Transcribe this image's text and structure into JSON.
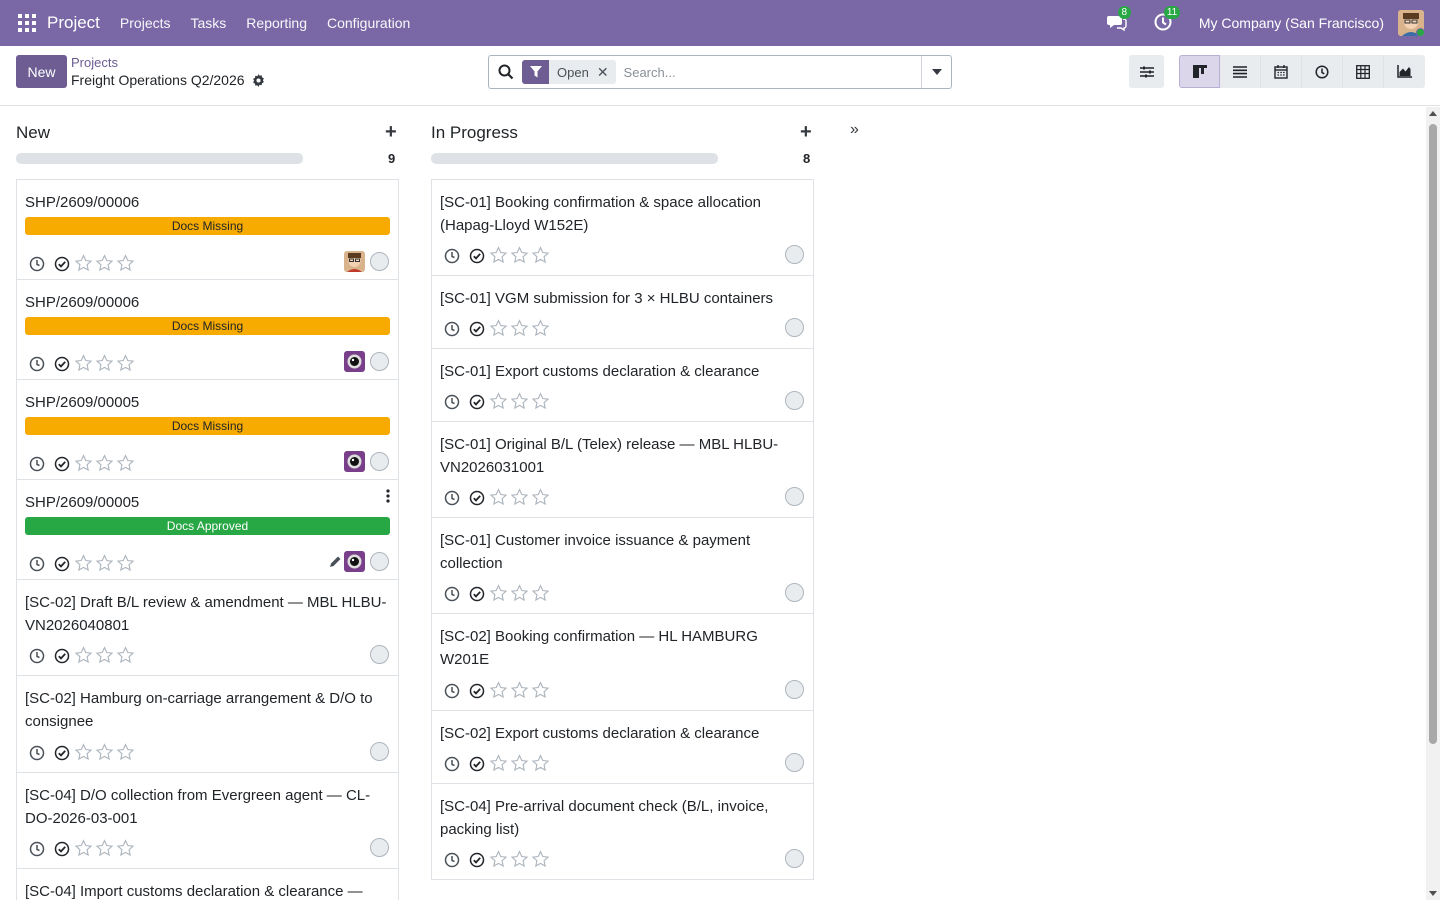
{
  "navbar": {
    "brand": "Project",
    "menu": [
      "Projects",
      "Tasks",
      "Reporting",
      "Configuration"
    ],
    "messages_count": "8",
    "activities_count": "11",
    "company": "My Company (San Francisco)",
    "accent_color": "#7a68a6"
  },
  "control": {
    "new_label": "New",
    "breadcrumb_parent": "Projects",
    "breadcrumb_current": "Freight Operations Q2/2026",
    "filter_facet": "Open",
    "search_placeholder": "Search...",
    "views": [
      "kanban-icon",
      "list-icon",
      "calendar-icon",
      "activity-icon",
      "pivot-icon",
      "graph-icon"
    ],
    "active_view": "kanban"
  },
  "columns": [
    {
      "title": "New",
      "count": "9",
      "cards": [
        {
          "title": "SHP/2609/00006",
          "tag": "Docs Missing",
          "tag_type": "missing",
          "assignee": "avatar-cartoon"
        },
        {
          "title": "SHP/2609/00006",
          "tag": "Docs Missing",
          "tag_type": "missing",
          "assignee": "avatar-camera"
        },
        {
          "title": "SHP/2609/00005",
          "tag": "Docs Missing",
          "tag_type": "missing",
          "assignee": "avatar-camera"
        },
        {
          "title": "SHP/2609/00005",
          "tag": "Docs Approved",
          "tag_type": "approved",
          "assignee": "avatar-camera"
        },
        {
          "title": "[SC-02] Draft B/L review & amendment — MBL HLBU-VN2026040801",
          "tag": "",
          "tag_type": "",
          "assignee": ""
        },
        {
          "title": "[SC-02] Hamburg on-carriage arrangement & D/O to consignee",
          "tag": "",
          "tag_type": "",
          "assignee": ""
        },
        {
          "title": "[SC-04] D/O collection from Evergreen agent — CL-DO-2026-03-001",
          "tag": "",
          "tag_type": "",
          "assignee": ""
        },
        {
          "title": "[SC-04] Import customs declaration & clearance —",
          "tag": "",
          "tag_type": "",
          "assignee": ""
        }
      ]
    },
    {
      "title": "In Progress",
      "count": "8",
      "cards": [
        {
          "title": "[SC-01] Booking confirmation & space allocation (Hapag-Lloyd W152E)"
        },
        {
          "title": "[SC-01] VGM submission for 3 × HLBU containers"
        },
        {
          "title": "[SC-01] Export customs declaration & clearance"
        },
        {
          "title": "[SC-01] Original B/L (Telex) release — MBL HLBU-VN2026031001"
        },
        {
          "title": "[SC-01] Customer invoice issuance & payment collection"
        },
        {
          "title": "[SC-02] Booking confirmation — HL HAMBURG W201E"
        },
        {
          "title": "[SC-02] Export customs declaration & clearance"
        },
        {
          "title": "[SC-04] Pre-arrival document check (B/L, invoice, packing list)"
        }
      ]
    }
  ],
  "colors": {
    "docs_missing": "#f7ab00",
    "docs_approved": "#28a745",
    "primary_button": "#6d5d92"
  }
}
